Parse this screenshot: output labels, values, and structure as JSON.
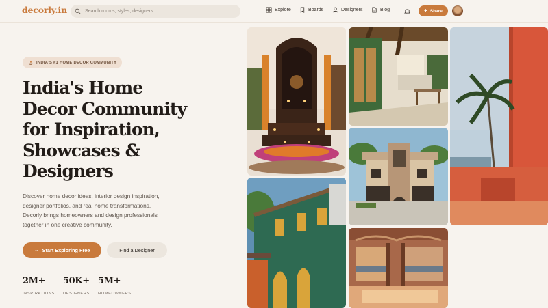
{
  "brand": {
    "logo_main": "decorly",
    "logo_suffix": ".in"
  },
  "search": {
    "placeholder": "Search rooms, styles, designers..."
  },
  "nav": {
    "items": [
      {
        "label": "Explore",
        "icon": "grid-icon"
      },
      {
        "label": "Boards",
        "icon": "bookmark-icon"
      },
      {
        "label": "Designers",
        "icon": "user-icon"
      },
      {
        "label": "Blog",
        "icon": "document-icon"
      }
    ],
    "share_label": "Share"
  },
  "hero": {
    "badge": "INDIA'S #1 HOME DECOR COMMUNITY",
    "headline_lines": [
      "India's Home",
      "Decor Community",
      "for Inspiration,",
      "Showcases &",
      "Designers"
    ],
    "subtext_lines": [
      "Discover home decor ideas, interior design inspiration,",
      "designer portfolios, and real home transformations.",
      "Decorly brings homeowners and design professionals",
      "together in one creative community."
    ],
    "cta_primary": "Start Exploring Free",
    "cta_secondary": "Find a Designer"
  },
  "stats": [
    {
      "value": "2M+",
      "label": "INSPIRATIONS"
    },
    {
      "value": "50K+",
      "label": "DESIGNERS"
    },
    {
      "value": "5M+",
      "label": "HOMEOWNERS"
    }
  ],
  "gallery": {
    "tiles": [
      "temple-shrine",
      "kitchen-dining",
      "courtyard-villa",
      "coastal-terrace",
      "green-colonial-house",
      "bedroom-balcony"
    ]
  },
  "colors": {
    "accent": "#c97a3c",
    "background": "#f7f3ee",
    "badge_bg": "#efdfd2"
  }
}
